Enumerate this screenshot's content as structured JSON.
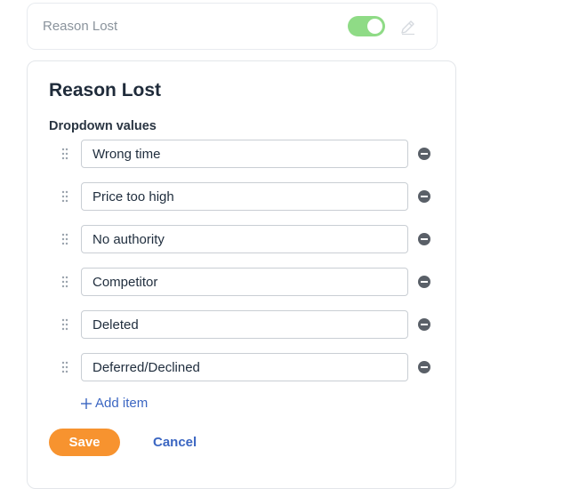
{
  "summary": {
    "label": "Reason Lost",
    "toggle_on": true,
    "toggle_color": "#8fdb86"
  },
  "editor": {
    "title": "Reason Lost",
    "section_label": "Dropdown values",
    "items": [
      "Wrong time",
      "Price too high",
      "No authority",
      "Competitor",
      "Deleted",
      "Deferred/Declined"
    ],
    "add_item_label": "Add item",
    "save_label": "Save",
    "cancel_label": "Cancel"
  },
  "colors": {
    "accent_orange": "#f7932f",
    "link_blue": "#3b66c2"
  },
  "icons": {
    "edit": "pencil-icon",
    "drag": "drag-handle-icon",
    "remove": "minus-circle-icon",
    "add": "plus-icon"
  }
}
